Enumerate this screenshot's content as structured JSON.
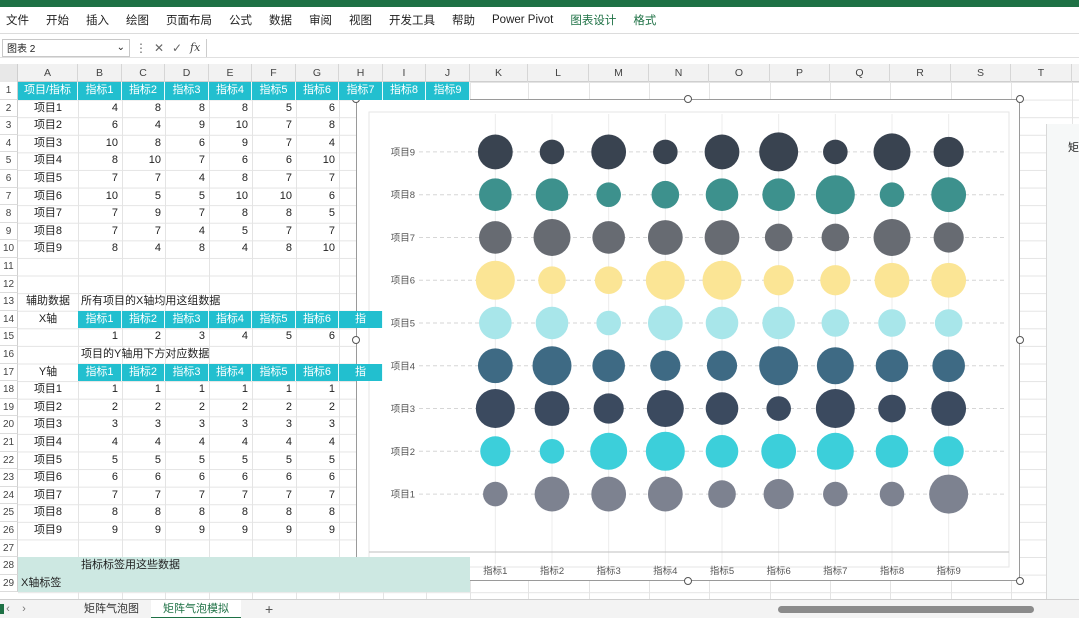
{
  "ribbon": {
    "tabs": [
      "文件",
      "开始",
      "插入",
      "绘图",
      "页面布局",
      "公式",
      "数据",
      "审阅",
      "视图",
      "开发工具",
      "帮助",
      "Power Pivot",
      "图表设计",
      "格式"
    ],
    "highlighted": [
      "图表设计",
      "格式"
    ]
  },
  "formula_bar": {
    "name_box": "图表 2",
    "fx": "fx",
    "formula": ""
  },
  "columns": [
    "A",
    "B",
    "C",
    "D",
    "E",
    "F",
    "G",
    "H",
    "I",
    "J",
    "K",
    "L",
    "M",
    "N",
    "O",
    "P",
    "Q",
    "R",
    "S",
    "T"
  ],
  "rows": [
    "1",
    "2",
    "3",
    "4",
    "5",
    "6",
    "7",
    "8",
    "9",
    "10",
    "11",
    "12",
    "13",
    "14",
    "15",
    "16",
    "17",
    "18",
    "19",
    "20",
    "21",
    "22",
    "23",
    "24",
    "25",
    "26",
    "27",
    "28",
    "29"
  ],
  "table1": {
    "corner": "项目/指标",
    "headers": [
      "指标1",
      "指标2",
      "指标3",
      "指标4",
      "指标5",
      "指标6",
      "指标7",
      "指标8",
      "指标9"
    ],
    "rows": [
      {
        "label": "项目1",
        "values": [
          4,
          8,
          8,
          8,
          5,
          6
        ]
      },
      {
        "label": "项目2",
        "values": [
          6,
          4,
          9,
          10,
          7,
          8
        ]
      },
      {
        "label": "项目3",
        "values": [
          10,
          8,
          6,
          9,
          7,
          4
        ]
      },
      {
        "label": "项目4",
        "values": [
          8,
          10,
          7,
          6,
          6,
          10
        ]
      },
      {
        "label": "项目5",
        "values": [
          7,
          7,
          4,
          8,
          7,
          7
        ]
      },
      {
        "label": "项目6",
        "values": [
          10,
          5,
          5,
          10,
          10,
          6
        ]
      },
      {
        "label": "项目7",
        "values": [
          7,
          9,
          7,
          8,
          8,
          5
        ]
      },
      {
        "label": "项目8",
        "values": [
          7,
          7,
          4,
          5,
          7,
          7
        ]
      },
      {
        "label": "项目9",
        "values": [
          8,
          4,
          8,
          4,
          8,
          10
        ]
      }
    ]
  },
  "aux": {
    "label": "辅助数据",
    "x_note": "所有项目的X轴均用这组数据",
    "x_label": "X轴",
    "x_headers": [
      "指标1",
      "指标2",
      "指标3",
      "指标4",
      "指标5",
      "指标6",
      "指"
    ],
    "x_values": [
      1,
      2,
      3,
      4,
      5,
      6
    ],
    "y_note": "项目的Y轴用下方对应数据",
    "y_label": "Y轴",
    "y_headers": [
      "指标1",
      "指标2",
      "指标3",
      "指标4",
      "指标5",
      "指标6",
      "指"
    ],
    "y_rows": [
      {
        "label": "项目1",
        "values": [
          1,
          1,
          1,
          1,
          1,
          1
        ]
      },
      {
        "label": "项目2",
        "values": [
          2,
          2,
          2,
          2,
          2,
          2
        ]
      },
      {
        "label": "项目3",
        "values": [
          3,
          3,
          3,
          3,
          3,
          3
        ]
      },
      {
        "label": "项目4",
        "values": [
          4,
          4,
          4,
          4,
          4,
          4
        ]
      },
      {
        "label": "项目5",
        "values": [
          5,
          5,
          5,
          5,
          5,
          5
        ]
      },
      {
        "label": "项目6",
        "values": [
          6,
          6,
          6,
          6,
          6,
          6
        ]
      },
      {
        "label": "项目7",
        "values": [
          7,
          7,
          7,
          7,
          7,
          7
        ]
      },
      {
        "label": "项目8",
        "values": [
          8,
          8,
          8,
          8,
          8,
          8
        ]
      },
      {
        "label": "项目9",
        "values": [
          9,
          9,
          9,
          9,
          9,
          9
        ]
      }
    ],
    "label_note": "指标标签用这些数据",
    "x_tick_label": "X轴标签"
  },
  "sheets": {
    "tabs": [
      "矩阵气泡图",
      "矩阵气泡模拟"
    ],
    "active": "矩阵气泡模拟",
    "add": "+"
  },
  "side_pane": {
    "label": "矩"
  },
  "chart_data": {
    "type": "scatter",
    "subtype": "bubble",
    "categories": [
      "指标1",
      "指标2",
      "指标3",
      "指标4",
      "指标5",
      "指标6",
      "指标7",
      "指标8",
      "指标9"
    ],
    "y_categories": [
      "项目1",
      "项目2",
      "项目3",
      "项目4",
      "项目5",
      "项目6",
      "项目7",
      "项目8",
      "项目9"
    ],
    "xlim": [
      0.5,
      9.5
    ],
    "ylim": [
      0.3,
      9.7
    ],
    "grid": "horizontal-dashed",
    "legend": "none",
    "series": [
      {
        "color": "#7d8290",
        "y": 1,
        "sizes": [
          4,
          8,
          8,
          8,
          5,
          6,
          4,
          4,
          10
        ]
      },
      {
        "color": "#3ccfda",
        "y": 2,
        "sizes": [
          6,
          4,
          9,
          10,
          7,
          8,
          9,
          7,
          6
        ]
      },
      {
        "color": "#3b4a5f",
        "y": 3,
        "sizes": [
          10,
          8,
          6,
          9,
          7,
          4,
          10,
          5,
          8
        ]
      },
      {
        "color": "#3e6a84",
        "y": 4,
        "sizes": [
          8,
          10,
          7,
          6,
          6,
          10,
          9,
          7,
          7
        ]
      },
      {
        "color": "#a8e6ea",
        "y": 5,
        "sizes": [
          7,
          7,
          4,
          8,
          7,
          7,
          5,
          5,
          5
        ]
      },
      {
        "color": "#fbe595",
        "y": 6,
        "sizes": [
          10,
          5,
          5,
          10,
          10,
          6,
          6,
          8,
          8
        ]
      },
      {
        "color": "#676b72",
        "y": 7,
        "sizes": [
          7,
          9,
          7,
          8,
          8,
          5,
          5,
          9,
          6
        ]
      },
      {
        "color": "#3d918d",
        "y": 8,
        "sizes": [
          7,
          7,
          4,
          5,
          7,
          7,
          10,
          4,
          8
        ]
      },
      {
        "color": "#394350",
        "y": 9,
        "sizes": [
          8,
          4,
          8,
          4,
          8,
          10,
          4,
          9,
          6
        ]
      }
    ]
  }
}
